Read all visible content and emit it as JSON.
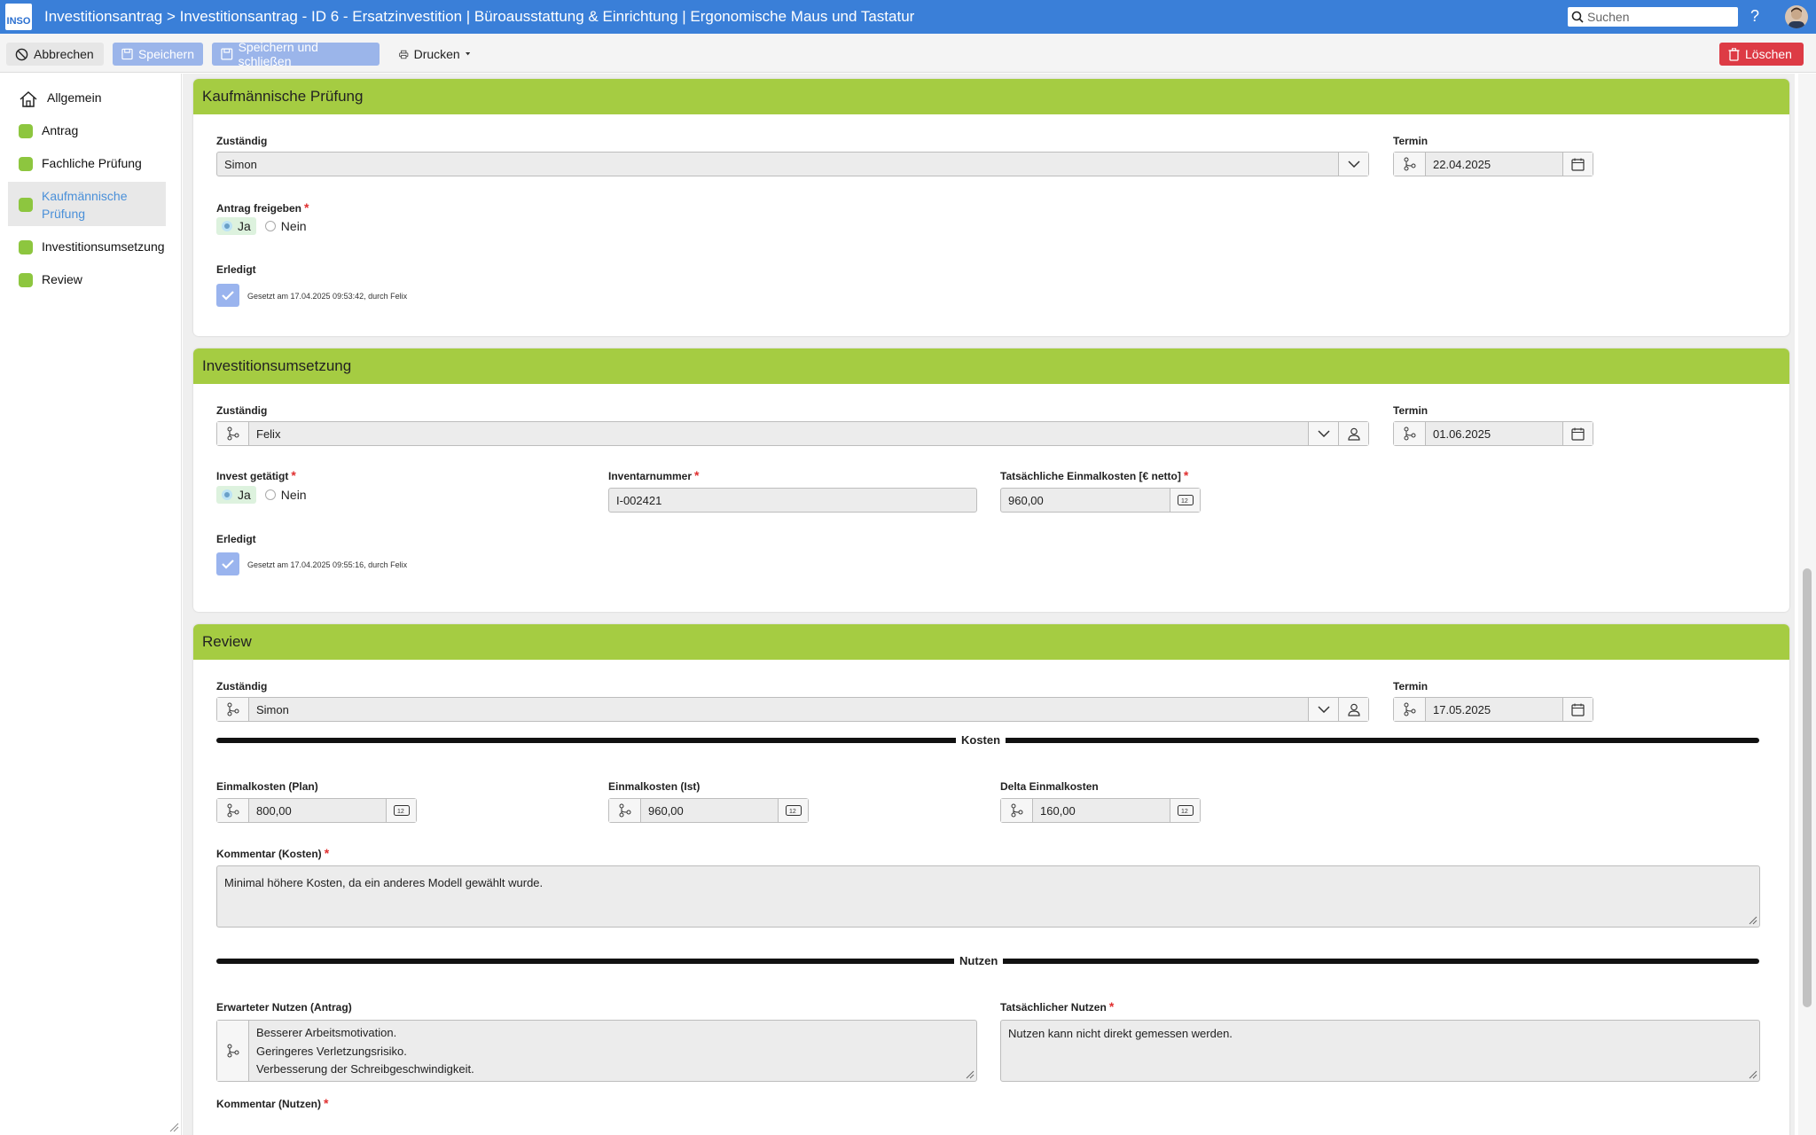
{
  "app": {
    "logo_text": "INSO",
    "title": "Investitionsantrag > Investitionsantrag - ID 6 - Ersatzinvestition | Büroausstattung & Einrichtung | Ergonomische Maus und Tastatur",
    "search_placeholder": "Suchen",
    "help": "?"
  },
  "toolbar": {
    "cancel": "Abbrechen",
    "save": "Speichern",
    "save_close": "Speichern und schließen",
    "print": "Drucken",
    "delete": "Löschen"
  },
  "sidebar": {
    "items": [
      {
        "label": "Allgemein",
        "icon": "home-icon"
      },
      {
        "label": "Antrag",
        "status_color": "#8dc63f"
      },
      {
        "label": "Fachliche Prüfung",
        "status_color": "#8dc63f"
      },
      {
        "label": "Kaufmännische Prüfung",
        "status_color": "#8dc63f",
        "active": true
      },
      {
        "label": "Investitionsumsetzung",
        "status_color": "#8dc63f"
      },
      {
        "label": "Review",
        "status_color": "#8dc63f"
      }
    ]
  },
  "kaufm": {
    "title": "Kaufmännische Prüfung",
    "zustaendig_label": "Zuständig",
    "zustaendig_value": "Simon",
    "termin_label": "Termin",
    "termin_value": "22.04.2025",
    "freigeben_label": "Antrag freigeben",
    "yes": "Ja",
    "no": "Nein",
    "erledigt_label": "Erledigt",
    "erledigt_note": "Gesetzt am 17.04.2025 09:53:42, durch Felix"
  },
  "invest": {
    "title": "Investitionsumsetzung",
    "zustaendig_label": "Zuständig",
    "zustaendig_value": "Felix",
    "termin_label": "Termin",
    "termin_value": "01.06.2025",
    "getaetigt_label": "Invest getätigt",
    "yes": "Ja",
    "no": "Nein",
    "inventar_label": "Inventarnummer",
    "inventar_value": "I-002421",
    "kosten_label": "Tatsächliche Einmalkosten [€ netto]",
    "kosten_value": "960,00",
    "erledigt_label": "Erledigt",
    "erledigt_note": "Gesetzt am 17.04.2025 09:55:16, durch Felix"
  },
  "review": {
    "title": "Review",
    "zustaendig_label": "Zuständig",
    "zustaendig_value": "Simon",
    "termin_label": "Termin",
    "termin_value": "17.05.2025",
    "kosten_divider": "Kosten",
    "plan_label": "Einmalkosten (Plan)",
    "plan_value": "800,00",
    "ist_label": "Einmalkosten (Ist)",
    "ist_value": "960,00",
    "delta_label": "Delta Einmalkosten",
    "delta_value": "160,00",
    "kommentar_kosten_label": "Kommentar (Kosten)",
    "kommentar_kosten_value": "Minimal höhere Kosten, da ein anderes Modell gewählt wurde.",
    "nutzen_divider": "Nutzen",
    "erwartet_label": "Erwarteter Nutzen (Antrag)",
    "erwartet_lines": [
      "Besserer Arbeitsmotivation.",
      "Geringeres Verletzungsrisiko.",
      "Verbesserung der Schreibgeschwindigkeit."
    ],
    "tatsaechlich_label": "Tatsächlicher Nutzen",
    "tatsaechlich_value": "Nutzen kann nicht direkt gemessen werden.",
    "kommentar_nutzen_label": "Kommentar (Nutzen)"
  }
}
